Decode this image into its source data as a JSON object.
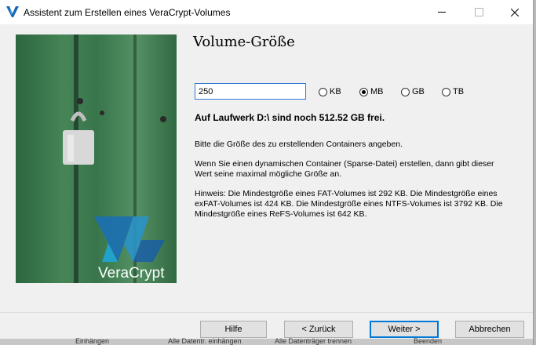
{
  "window": {
    "title": "Assistent zum Erstellen eines VeraCrypt-Volumes"
  },
  "hero": {
    "brand": "VeraCrypt"
  },
  "page": {
    "title": "Volume-Größe"
  },
  "size_input": {
    "value": "250"
  },
  "units": [
    {
      "label": "KB",
      "selected": false
    },
    {
      "label": "MB",
      "selected": true
    },
    {
      "label": "GB",
      "selected": false
    },
    {
      "label": "TB",
      "selected": false
    }
  ],
  "free_space": "Auf Laufwerk D:\\ sind noch 512.52 GB frei.",
  "info": {
    "p1": "Bitte die Größe des zu erstellenden Containers angeben.",
    "p2": "Wenn Sie einen dynamischen Container (Sparse-Datei) erstellen, dann gibt dieser Wert seine maximal mögliche Größe an.",
    "p3": "Hinweis: Die Mindestgröße eines FAT-Volumes ist 292 KB. Die Mindestgröße eines exFAT-Volumes ist 424 KB. Die Mindestgröße eines NTFS-Volumes ist 3792 KB. Die Mindestgröße eines ReFS-Volumes ist 642 KB."
  },
  "buttons": {
    "help": "Hilfe",
    "back": "< Zurück",
    "next": "Weiter >",
    "cancel": "Abbrechen"
  },
  "background_strip": {
    "item1": "Einhängen",
    "item2": "Alle Datentr. einhängen",
    "item3": "Alle Datenträger trennen",
    "item4": "Beenden"
  },
  "colors": {
    "accent": "#0078d7",
    "hero_green": "#3e7a4f"
  }
}
